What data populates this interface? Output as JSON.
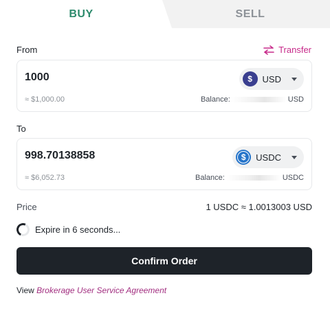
{
  "tabs": {
    "buy": "BUY",
    "sell": "SELL"
  },
  "from": {
    "label": "From",
    "transfer_label": "Transfer",
    "amount": "1000",
    "approx": "≈ $1,000.00",
    "balance_label": "Balance:",
    "balance_currency": "USD",
    "currency": "USD",
    "currency_icon": "$"
  },
  "to": {
    "label": "To",
    "amount": "998.70138858",
    "approx": "≈ $6,052.73",
    "balance_label": "Balance:",
    "balance_currency": "USDC",
    "currency": "USDC",
    "currency_icon": "$"
  },
  "price": {
    "label": "Price",
    "value": "1 USDC ≈ 1.0013003 USD"
  },
  "expire_text": "Expire in 6 seconds...",
  "confirm_label": "Confirm Order",
  "agreement": {
    "prefix": "View ",
    "link": "Brokerage User Service Agreement"
  },
  "colors": {
    "buy_tab": "#2e8b6d",
    "accent": "#c72a8a",
    "button": "#1e2329",
    "link": "#a12d7f"
  }
}
